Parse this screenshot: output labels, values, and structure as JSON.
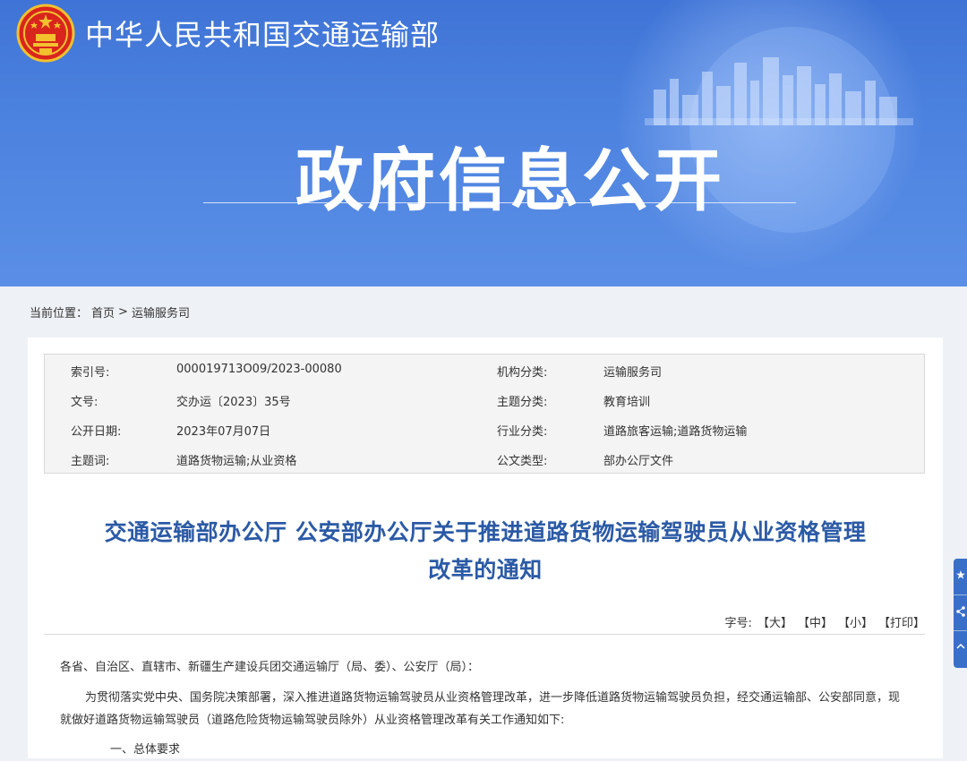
{
  "header": {
    "ministry_name": "中华人民共和国交通运输部",
    "banner_title": "政府信息公开",
    "emblem_icon": "national-emblem"
  },
  "breadcrumb": {
    "prefix": "当前位置：",
    "items": [
      "首页",
      "运输服务司"
    ],
    "separator": ">"
  },
  "meta": {
    "rows": [
      {
        "k1": "索引号:",
        "v1": "000019713O09/2023-00080",
        "k2": "机构分类:",
        "v2": "运输服务司"
      },
      {
        "k1": "文号:",
        "v1": "交办运〔2023〕35号",
        "k2": "主题分类:",
        "v2": "教育培训"
      },
      {
        "k1": "公开日期:",
        "v1": "2023年07月07日",
        "k2": "行业分类:",
        "v2": "道路旅客运输;道路货物运输"
      },
      {
        "k1": "主题词:",
        "v1": "道路货物运输;从业资格",
        "k2": "公文类型:",
        "v2": "部办公厅文件"
      }
    ]
  },
  "document": {
    "title_line1": "交通运输部办公厅 公安部办公厅关于推进道路货物运输驾驶员从业资格管理",
    "title_line2": "改革的通知",
    "salutation": "各省、自治区、直辖市、新疆生产建设兵团交通运输厅（局、委）、公安厅（局）：",
    "paragraph1": "为贯彻落实党中央、国务院决策部署，深入推进道路货物运输驾驶员从业资格管理改革，进一步降低道路货物运输驾驶员负担，经交通运输部、公安部同意，现就做好道路货物运输驾驶员（道路危险货物运输驾驶员除外）从业资格管理改革有关工作通知如下:",
    "clipped_line": "一、总体要求"
  },
  "font_tools": {
    "label": "字号:",
    "large": "【大】",
    "medium": "【中】",
    "small": "【小】",
    "print": "【打印】"
  },
  "side_widget": {
    "icons": [
      "star-icon",
      "share-icon",
      "scroll-top-icon"
    ]
  },
  "colors": {
    "banner_blue": "#4a7fdd",
    "title_blue": "#2b5aa6",
    "side_widget": "#3a6fc9"
  }
}
